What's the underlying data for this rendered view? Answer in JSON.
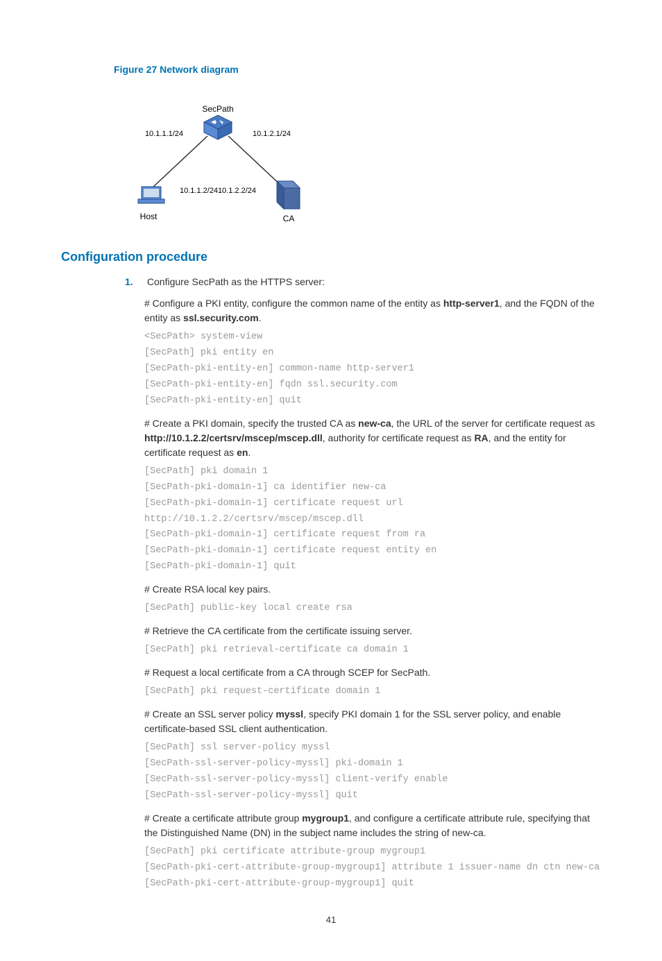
{
  "figure": {
    "caption": "Figure 27 Network diagram",
    "nodes": {
      "secpath": "SecPath",
      "host": "Host",
      "ca": "CA",
      "sp_left": "10.1.1.1/24",
      "sp_right": "10.1.2.1/24",
      "host_ip": "10.1.1.2/24",
      "ca_ip": "10.1.2.2/24"
    }
  },
  "section_heading": "Configuration procedure",
  "step1": {
    "num": "1.",
    "title": "Configure SecPath as the HTTPS server:",
    "p1a": "# Configure a PKI entity, configure the common name of the entity as ",
    "p1b": "http-server1",
    "p1c": ", and the FQDN of the entity as ",
    "p1d": "ssl.security.com",
    "p1e": ".",
    "code1": "<SecPath> system-view\n[SecPath] pki entity en\n[SecPath-pki-entity-en] common-name http-server1\n[SecPath-pki-entity-en] fqdn ssl.security.com\n[SecPath-pki-entity-en] quit",
    "p2a": "# Create a PKI domain, specify the trusted CA as ",
    "p2b": "new-ca",
    "p2c": ", the URL of the server for certificate request as ",
    "p2d": "http://10.1.2.2/certsrv/mscep/mscep.dll",
    "p2e": ", authority for certificate request as ",
    "p2f": "RA",
    "p2g": ", and the entity for certificate request as ",
    "p2h": "en",
    "p2i": ".",
    "code2": "[SecPath] pki domain 1\n[SecPath-pki-domain-1] ca identifier new-ca\n[SecPath-pki-domain-1] certificate request url\nhttp://10.1.2.2/certsrv/mscep/mscep.dll\n[SecPath-pki-domain-1] certificate request from ra\n[SecPath-pki-domain-1] certificate request entity en\n[SecPath-pki-domain-1] quit",
    "p3": "# Create RSA local key pairs.",
    "code3": "[SecPath] public-key local create rsa",
    "p4": "# Retrieve the CA certificate from the certificate issuing server.",
    "code4": "[SecPath] pki retrieval-certificate ca domain 1",
    "p5": "# Request a local certificate from a CA through SCEP for SecPath.",
    "code5": "[SecPath] pki request-certificate domain 1",
    "p6a": "# Create an SSL server policy ",
    "p6b": "myssl",
    "p6c": ", specify PKI domain 1 for the SSL server policy, and enable certificate-based SSL client authentication.",
    "code6": "[SecPath] ssl server-policy myssl\n[SecPath-ssl-server-policy-myssl] pki-domain 1\n[SecPath-ssl-server-policy-myssl] client-verify enable\n[SecPath-ssl-server-policy-myssl] quit",
    "p7a": "# Create a certificate attribute group ",
    "p7b": "mygroup1",
    "p7c": ", and configure a certificate attribute rule, specifying that the Distinguished Name (DN) in the subject name includes the string of new-ca.",
    "code7": "[SecPath] pki certificate attribute-group mygroup1\n[SecPath-pki-cert-attribute-group-mygroup1] attribute 1 issuer-name dn ctn new-ca\n[SecPath-pki-cert-attribute-group-mygroup1] quit"
  },
  "page_number": "41"
}
